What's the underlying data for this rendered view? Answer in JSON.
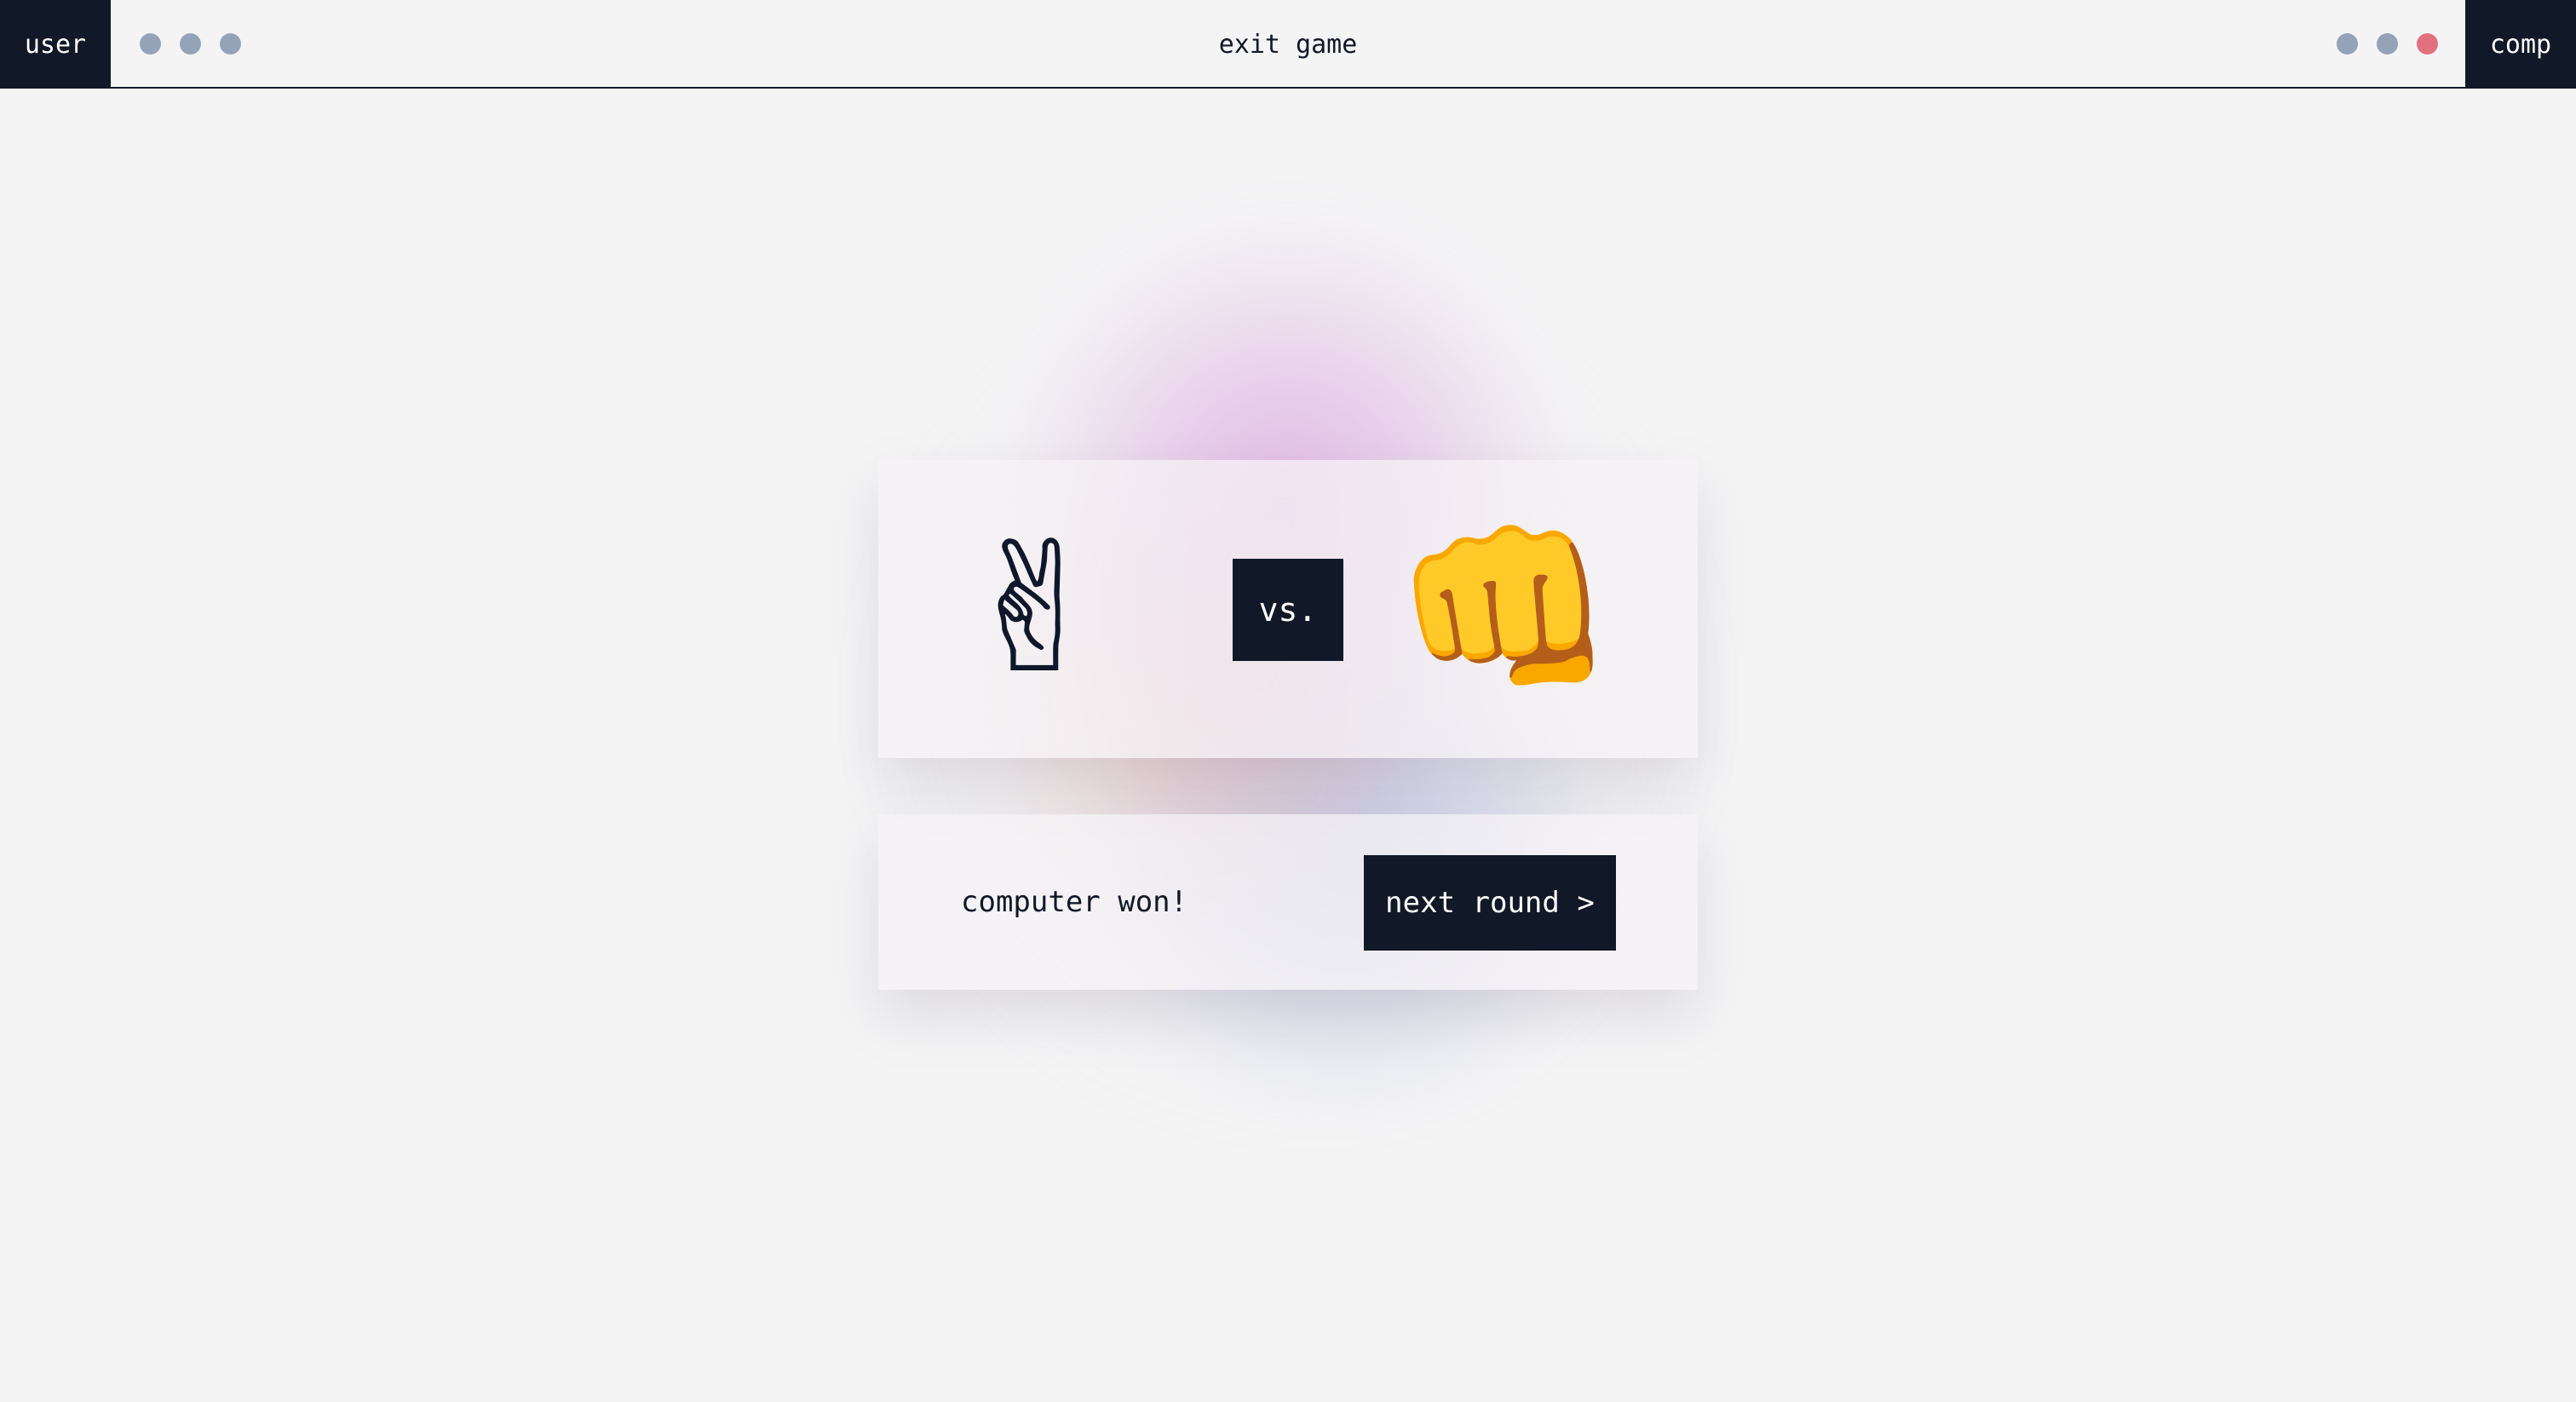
{
  "header": {
    "user_label": "user",
    "comp_label": "comp",
    "exit_label": "exit game",
    "user_lives": [
      "remaining",
      "remaining",
      "remaining"
    ],
    "comp_lives": [
      "remaining",
      "remaining",
      "lost"
    ]
  },
  "battle": {
    "user_choice": "scissors",
    "user_emoji": "✌",
    "vs_label": "vs.",
    "comp_choice": "rock",
    "comp_emoji": "👊"
  },
  "result": {
    "message": "computer won!",
    "next_label": "next round >"
  },
  "colors": {
    "dark": "#111827",
    "dot": "#94a3b8",
    "dot_lost": "#e27180",
    "background": "#f4f4f5"
  }
}
